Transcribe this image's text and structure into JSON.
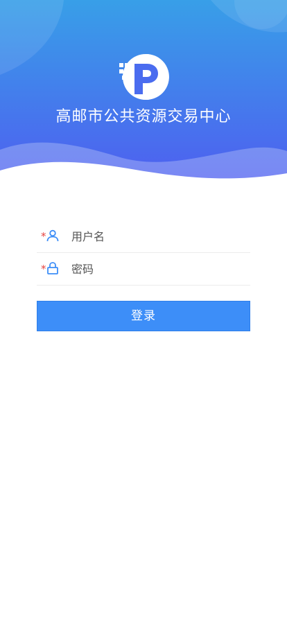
{
  "header": {
    "app_title": "高邮市公共资源交易中心",
    "logo_icon": "p-logo-icon",
    "gradient_top": "#3a9ee8",
    "gradient_bottom": "#4a66ee"
  },
  "login_form": {
    "username": {
      "required_mark": "*",
      "icon": "user-icon",
      "value": "",
      "placeholder": "用户名"
    },
    "password": {
      "required_mark": "*",
      "icon": "lock-icon",
      "value": "",
      "placeholder": "密码"
    },
    "submit_label": "登录",
    "accent_color": "#3d8ef8"
  }
}
